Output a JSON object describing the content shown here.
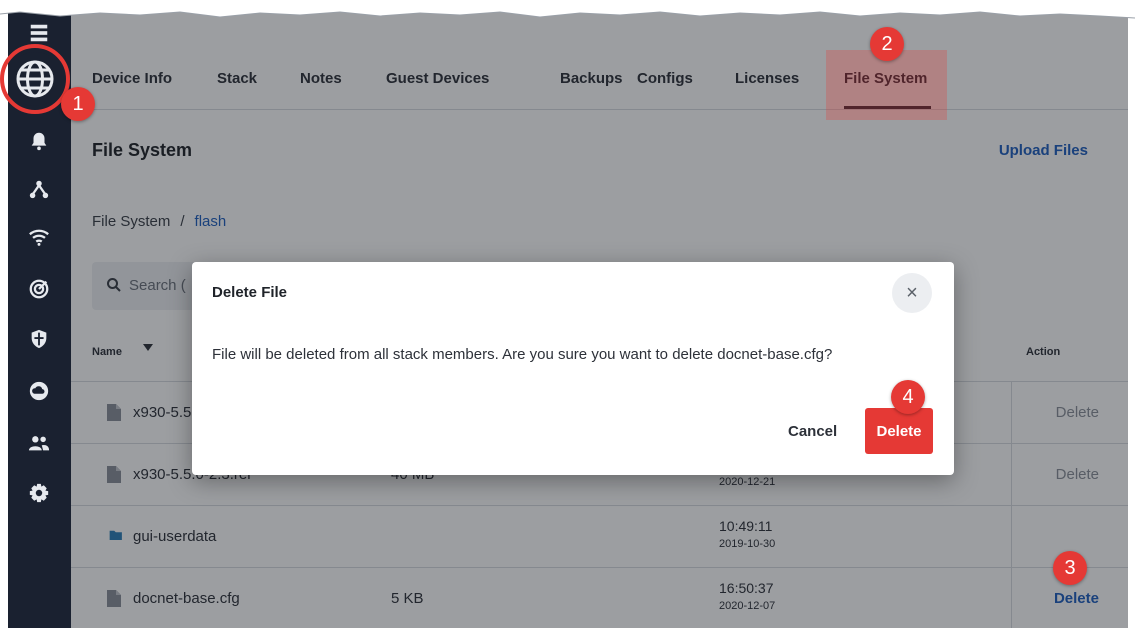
{
  "colors": {
    "sidebar_bg": "#1a2130",
    "accent_link": "#1f5fbf",
    "danger": "#e53935",
    "callout": "#e53935"
  },
  "sidebar": {
    "items": [
      {
        "icon": "grid-icon"
      },
      {
        "icon": "globe-icon"
      },
      {
        "icon": "bell-icon"
      },
      {
        "icon": "topology-icon"
      },
      {
        "icon": "wifi-icon"
      },
      {
        "icon": "radar-icon"
      },
      {
        "icon": "shield-icon"
      },
      {
        "icon": "cloud-icon"
      },
      {
        "icon": "users-icon"
      },
      {
        "icon": "gear-icon"
      }
    ]
  },
  "tabs": [
    {
      "label": "Device Info"
    },
    {
      "label": "Stack"
    },
    {
      "label": "Notes"
    },
    {
      "label": "Guest Devices"
    },
    {
      "label": "Backups"
    },
    {
      "label": "Configs"
    },
    {
      "label": "Licenses"
    },
    {
      "label": "File System",
      "active": true
    }
  ],
  "page": {
    "title": "File System",
    "upload_label": "Upload Files",
    "breadcrumb": {
      "root": "File System",
      "separator": "/",
      "current": "flash"
    },
    "search_placeholder": "Search ("
  },
  "table": {
    "columns": {
      "name": "Name",
      "action": "Action"
    },
    "rows": [
      {
        "name": "x930-5.5",
        "size": "",
        "time": "",
        "date": "",
        "action": "Delete",
        "type": "file",
        "action_enabled": false
      },
      {
        "name": "x930-5.5.0-2.3.rel",
        "size": "40 MB",
        "time": "",
        "date": "2020-12-21",
        "action": "Delete",
        "type": "file",
        "action_enabled": false
      },
      {
        "name": "gui-userdata",
        "size": "",
        "time": "10:49:11",
        "date": "2019-10-30",
        "action": "",
        "type": "folder",
        "action_enabled": false
      },
      {
        "name": "docnet-base.cfg",
        "size": "5 KB",
        "time": "16:50:37",
        "date": "2020-12-07",
        "action": "Delete",
        "type": "file",
        "action_enabled": true
      }
    ]
  },
  "dialog": {
    "title": "Delete File",
    "close_glyph": "×",
    "message": "File will be deleted from all stack members. Are you sure you want to delete docnet-base.cfg?",
    "cancel_label": "Cancel",
    "delete_label": "Delete"
  },
  "callouts": [
    "1",
    "2",
    "3",
    "4"
  ]
}
